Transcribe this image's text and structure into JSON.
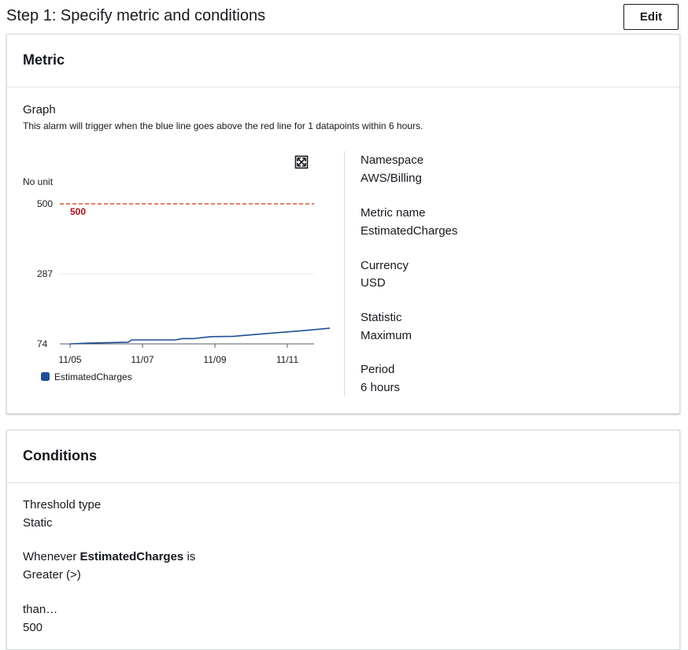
{
  "header": {
    "title": "Step 1: Specify metric and conditions",
    "edit_label": "Edit"
  },
  "metric_card": {
    "title": "Metric",
    "graph_label": "Graph",
    "graph_description": "This alarm will trigger when the blue line goes above the red line for 1 datapoints within 6 hours.",
    "details": [
      {
        "label": "Namespace",
        "value": "AWS/Billing"
      },
      {
        "label": "Metric name",
        "value": "EstimatedCharges"
      },
      {
        "label": "Currency",
        "value": "USD"
      },
      {
        "label": "Statistic",
        "value": "Maximum"
      },
      {
        "label": "Period",
        "value": "6 hours"
      }
    ]
  },
  "chart_data": {
    "type": "line",
    "ylabel": "No unit",
    "ylim": [
      74,
      500
    ],
    "yticks": [
      "500",
      "287",
      "74"
    ],
    "xticks": [
      "11/05",
      "11/07",
      "11/09",
      "11/11"
    ],
    "threshold": {
      "value": 500,
      "label": "500",
      "color": "#d13212"
    },
    "series": [
      {
        "name": "EstimatedCharges",
        "color": "#1f4e96",
        "x": [
          0,
          0.4,
          0.8,
          1.2,
          1.6,
          1.7,
          2.0,
          2.5,
          2.9,
          3.1,
          3.4,
          3.9,
          4.5,
          5.5,
          6.4,
          7.2,
          7.95
        ],
        "values": [
          74,
          76,
          77,
          78,
          79,
          86,
          86,
          86,
          86,
          90,
          90,
          96,
          97,
          106,
          114,
          122,
          130
        ]
      }
    ],
    "legend": "bottom-left"
  },
  "conditions_card": {
    "title": "Conditions",
    "threshold_type_label": "Threshold type",
    "threshold_type_value": "Static",
    "whenever_prefix": "Whenever",
    "whenever_metric": "EstimatedCharges",
    "whenever_suffix": "is",
    "comparison_value": "Greater (>)",
    "than_label": "than…",
    "than_value": "500"
  },
  "colors": {
    "threshold": "#d13212",
    "series": "#1f4e96",
    "border": "#d5dbdb"
  },
  "icons": {
    "expand": "expand-icon"
  }
}
